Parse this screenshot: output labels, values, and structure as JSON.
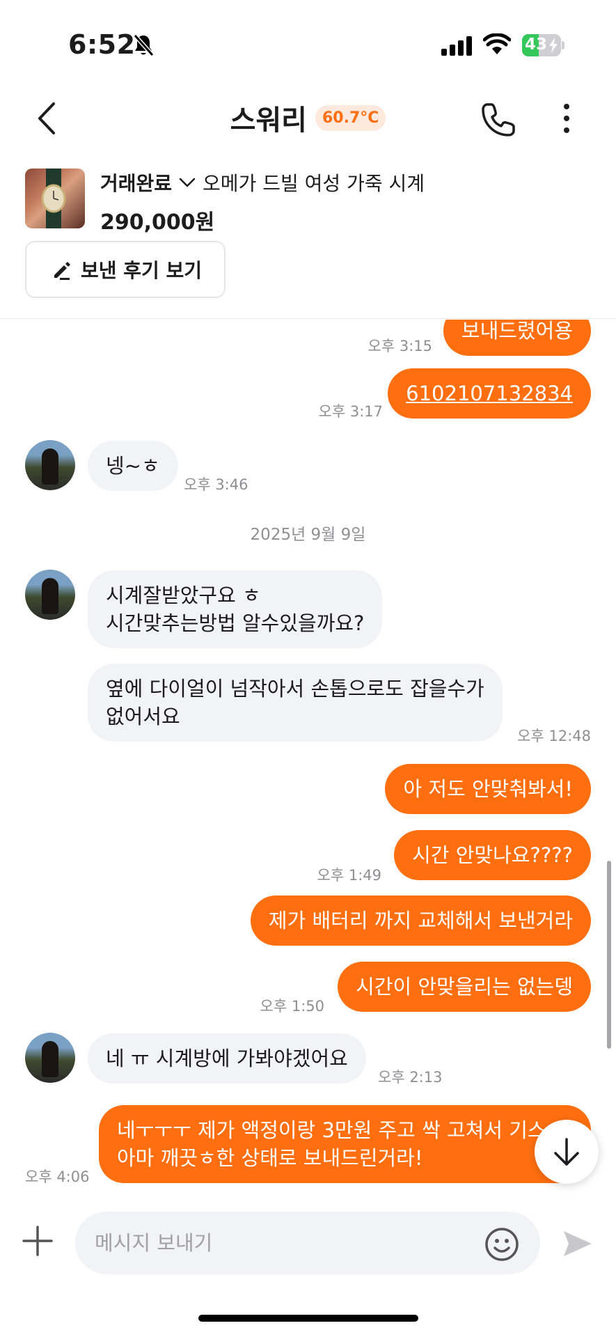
{
  "status_bar": {
    "time": "6:52",
    "battery_percent": "43",
    "battery_level": 0.43
  },
  "header": {
    "title": "스워리",
    "temperature": "60.7°C"
  },
  "product": {
    "status": "거래완료",
    "name": "오메가 드빌 여성 가죽 시계",
    "price": "290,000원",
    "review_button": "보낸 후기 보기"
  },
  "chat": {
    "messages": [
      {
        "text": "보내드렸어용",
        "time": "오후 3:15"
      },
      {
        "text": "6102107132834",
        "time": "오후 3:17"
      },
      {
        "text": "넹~ㅎ",
        "time": "오후 3:46"
      },
      {
        "date": "2025년 9월 9일"
      },
      {
        "line1": "시계잘받았구요 ㅎ",
        "line2": "시간맞추는방법 알수있을까요?"
      },
      {
        "line1": "옆에 다이얼이 넘작아서 손톱으로도 잡을수가",
        "line2": "없어서요",
        "time": "오후 12:48"
      },
      {
        "text": "아 저도 안맞춰봐서!"
      },
      {
        "text": "시간 안맞나요????",
        "time": "오후 1:49"
      },
      {
        "text": "제가 배터리 까지 교체해서 보낸거라"
      },
      {
        "text": "시간이 안맞을리는 없는뎅",
        "time": "오후 1:50"
      },
      {
        "text": "네 ㅠ 시계방에 가봐야겠어요",
        "time": "오후 2:13"
      },
      {
        "line1": "네ㅜㅜㅜ 제가 액정이랑 3만원 주고 싹 고쳐서 기스",
        "line2": "아마 깨끗ㅎ한 상태로 보내드린거라!",
        "time": "오후 4:06"
      }
    ]
  },
  "input": {
    "placeholder": "메시지 보내기"
  },
  "colors": {
    "accent": "#ff6f0f",
    "incoming_bubble": "#f2f3f6",
    "battery_green": "#34c759"
  }
}
